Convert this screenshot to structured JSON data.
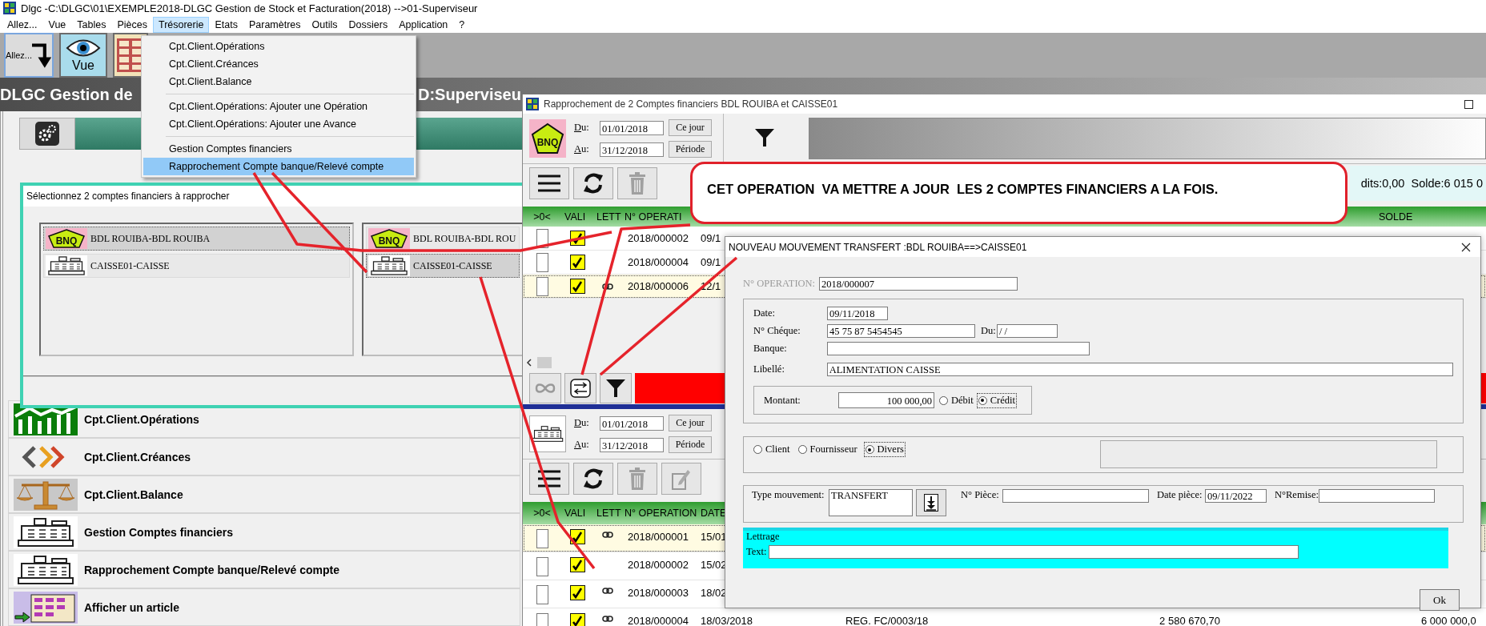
{
  "window": {
    "title": "Dlgc -C:\\DLGC\\01\\EXEMPLE2018-DLGC Gestion de Stock et Facturation(2018) -->01-Superviseur"
  },
  "menu_bar": [
    {
      "label": "Allez...",
      "selected": false
    },
    {
      "label": "Vue",
      "selected": false
    },
    {
      "label": "Tables",
      "selected": false
    },
    {
      "label": "Pièces",
      "selected": false
    },
    {
      "label": "Trésorerie",
      "selected": true
    },
    {
      "label": "Etats",
      "selected": false
    },
    {
      "label": "Paramètres",
      "selected": false
    },
    {
      "label": "Outils",
      "selected": false
    },
    {
      "label": "Dossiers",
      "selected": false
    },
    {
      "label": "Application",
      "selected": false
    },
    {
      "label": "?",
      "selected": false
    }
  ],
  "menu_dropdown": {
    "groups": [
      [
        {
          "label": "Cpt.Client.Opérations",
          "selected": false
        },
        {
          "label": "Cpt.Client.Créances",
          "selected": false
        },
        {
          "label": "Cpt.Client.Balance",
          "selected": false
        }
      ],
      [
        {
          "label": "Cpt.Client.Opérations: Ajouter une Opération",
          "selected": false
        },
        {
          "label": "Cpt.Client.Opérations: Ajouter une Avance",
          "selected": false
        }
      ],
      [
        {
          "label": "Gestion Comptes financiers",
          "selected": false
        },
        {
          "label": "Rapprochement Compte banque/Relevé compte",
          "selected": true
        }
      ]
    ]
  },
  "toolbar": [
    {
      "kind": "goto",
      "label": "Allez..."
    },
    {
      "kind": "eye",
      "label": "Vue"
    },
    {
      "kind": "grid"
    }
  ],
  "banner": {
    "title": "DLGC Gestion de",
    "user": "D:Superviseu"
  },
  "modules": [
    {
      "kind": "chart",
      "label": "Cpt.Client.Opérations"
    },
    {
      "kind": "chevrons",
      "label": "Cpt.Client.Créances"
    },
    {
      "kind": "scale",
      "label": "Cpt.Client.Balance"
    },
    {
      "kind": "register",
      "label": "Gestion Comptes financiers"
    },
    {
      "kind": "register",
      "label": "Rapprochement Compte banque/Relevé compte"
    },
    {
      "kind": "article",
      "label": "Afficher un article"
    }
  ],
  "select_dialog": {
    "title": "Sélectionnez 2 comptes financiers à rapprocher",
    "left_list": [
      {
        "kind": "bank",
        "badge": "BNQ",
        "label": "BDL ROUIBA-BDL ROUIBA",
        "selected": true
      },
      {
        "kind": "cash",
        "label": "CAISSE01-CAISSE",
        "selected": false
      }
    ],
    "right_list": [
      {
        "kind": "bank",
        "badge": "BNQ",
        "label": "BDL ROUIBA-BDL ROU",
        "selected": false
      },
      {
        "kind": "cash",
        "label": "CAISSE01-CAISSE",
        "selected": true
      }
    ]
  },
  "reconcile_window": {
    "title": "Rapprochement de 2 Comptes financiers BDL ROUIBA et CAISSE01",
    "sections": [
      {
        "kind": "bank",
        "badge": "BNQ",
        "from_label": "Du:",
        "from": "01/01/2018",
        "to_label": "Au:",
        "to": "31/12/2018",
        "buttons": [
          "Ce jour",
          "Période"
        ],
        "tools": [
          {
            "kind": "menu"
          },
          {
            "kind": "refresh"
          },
          {
            "kind": "trash"
          }
        ],
        "summary": "dits:0,00  Solde:6 015 0",
        "columns": [
          ">0<",
          "VALI",
          "LETT",
          "N° OPERATI",
          "SOLDE"
        ],
        "rows": [
          {
            "checked": false,
            "valid": true,
            "lettered": false,
            "number": "2018/000002",
            "date": "09/1",
            "selected": false
          },
          {
            "checked": false,
            "valid": true,
            "lettered": false,
            "number": "2018/000004",
            "date": "09/1",
            "selected": false
          },
          {
            "checked": false,
            "valid": true,
            "lettered": true,
            "number": "2018/000006",
            "date": "12/1",
            "selected": true
          }
        ]
      },
      {
        "kind": "cash",
        "from_label": "Du:",
        "from": "01/01/2018",
        "to_label": "Au:",
        "to": "31/12/2018",
        "buttons": [
          "Ce jour",
          "Période"
        ],
        "tools": [
          {
            "kind": "menu"
          },
          {
            "kind": "refresh"
          },
          {
            "kind": "trash"
          },
          {
            "kind": "edit"
          }
        ],
        "columns": [
          ">0<",
          "VALI",
          "LETT",
          "N° OPERATION",
          "DATE"
        ],
        "rows": [
          {
            "checked": false,
            "valid": true,
            "lettered": true,
            "number": "2018/000001",
            "date": "15/01",
            "selected": true
          },
          {
            "checked": false,
            "valid": true,
            "lettered": false,
            "number": "2018/000002",
            "date": "15/02",
            "selected": false
          },
          {
            "checked": false,
            "valid": true,
            "lettered": true,
            "number": "2018/000003",
            "date": "18/02",
            "selected": false
          },
          {
            "checked": false,
            "valid": true,
            "lettered": true,
            "number": "2018/000004",
            "date": "18/03/2018",
            "label": "REG. FC/0003/18",
            "amount": "2 580 670,70",
            "balance": "6 000 000,0",
            "selected": false
          }
        ]
      }
    ],
    "bottom_tools": [
      {
        "kind": "infinity"
      },
      {
        "kind": "transfer"
      },
      {
        "kind": "filter"
      }
    ]
  },
  "callout": "CET OPERATION  VA METTRE A JOUR  LES 2 COMPTES FINANCIERS A LA FOIS.",
  "movement_dialog": {
    "title": "NOUVEAU MOUVEMENT TRANSFERT :BDL ROUIBA==>CAISSE01",
    "operation": {
      "label": "N° OPERATION:",
      "value": "2018/000007",
      "disabled": true
    },
    "date": {
      "label": "Date:",
      "value": "09/11/2018"
    },
    "cheque": {
      "label": "N° Chéque:",
      "value": "45 75 87 5454545"
    },
    "cheque_date": {
      "label": "Du:",
      "value": "/ /"
    },
    "bank": {
      "label": "Banque:"
    },
    "description": {
      "label": "Libellé:",
      "value": "ALIMENTATION CAISSE"
    },
    "amount": {
      "label": "Montant:",
      "value": "100 000,00"
    },
    "direction": [
      {
        "label": "Débit",
        "selected": false
      },
      {
        "label": "Crédit",
        "selected": true
      }
    ],
    "party": [
      {
        "label": "Client",
        "selected": false
      },
      {
        "label": "Fournisseur",
        "selected": false
      },
      {
        "label": "Divers",
        "selected": true
      }
    ],
    "movement_type": {
      "label": "Type mouvement:",
      "value": "TRANSFERT"
    },
    "piece": {
      "label": "N° Pièce:"
    },
    "piece_date": {
      "label": "Date pièce:",
      "value": "09/11/2022"
    },
    "remise": {
      "label": "N°Remise:"
    },
    "lettering": {
      "title": "Lettrage",
      "label": "Text:"
    },
    "ok_button": "Ok"
  }
}
